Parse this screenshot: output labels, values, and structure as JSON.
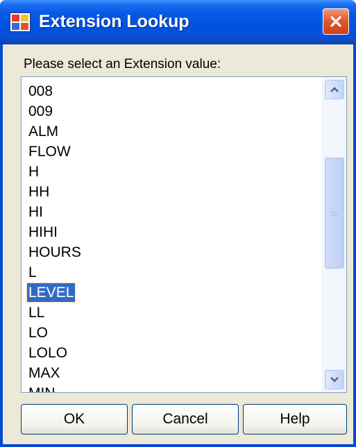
{
  "window": {
    "title": "Extension Lookup",
    "app_icon": "app-window-icon",
    "close_icon": "close-icon",
    "titlebar_color": "#0053e1"
  },
  "prompt": "Please select an Extension value:",
  "list": {
    "items": [
      "008",
      "009",
      "ALM",
      "FLOW",
      "H",
      "HH",
      "HI",
      "HIHI",
      "HOURS",
      "L",
      "LEVEL",
      "LL",
      "LO",
      "LOLO",
      "MAX",
      "MIN"
    ],
    "selected": "LEVEL",
    "selection_color": "#316ac5"
  },
  "scrollbar": {
    "up_icon": "chevron-up-icon",
    "down_icon": "chevron-down-icon",
    "thumb_grip_icon": "grip-icon"
  },
  "buttons": {
    "ok": "OK",
    "cancel": "Cancel",
    "help": "Help"
  }
}
